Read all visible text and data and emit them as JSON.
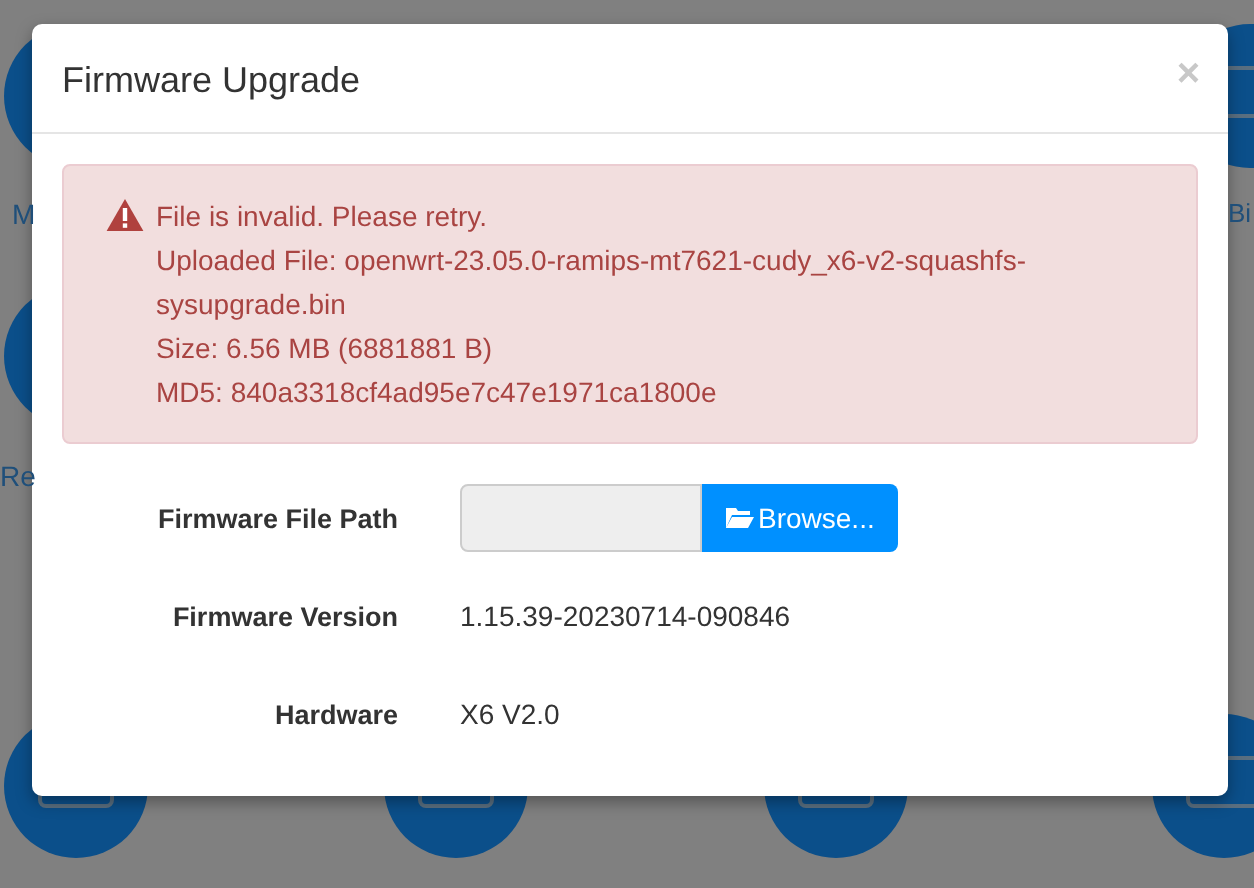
{
  "background": {
    "labels": [
      "M",
      "Bi",
      "Re"
    ]
  },
  "dialog": {
    "title": "Firmware Upgrade",
    "close": "×",
    "alert": {
      "lines": [
        "File is invalid. Please retry.",
        "Uploaded File: openwrt-23.05.0-ramips-mt7621-cudy_x6-v2-squashfs-sysupgrade.bin",
        "Size: 6.56 MB (6881881 B)",
        "MD5: 840a3318cf4ad95e7c47e1971ca1800e"
      ]
    },
    "fields": [
      {
        "kind": "file",
        "label": "Firmware File Path",
        "button": "Browse..."
      },
      {
        "kind": "text",
        "label": "Firmware Version",
        "value": "1.15.39-20230714-090846"
      },
      {
        "kind": "text",
        "label": "Hardware",
        "value": "X6 V2.0"
      }
    ]
  }
}
